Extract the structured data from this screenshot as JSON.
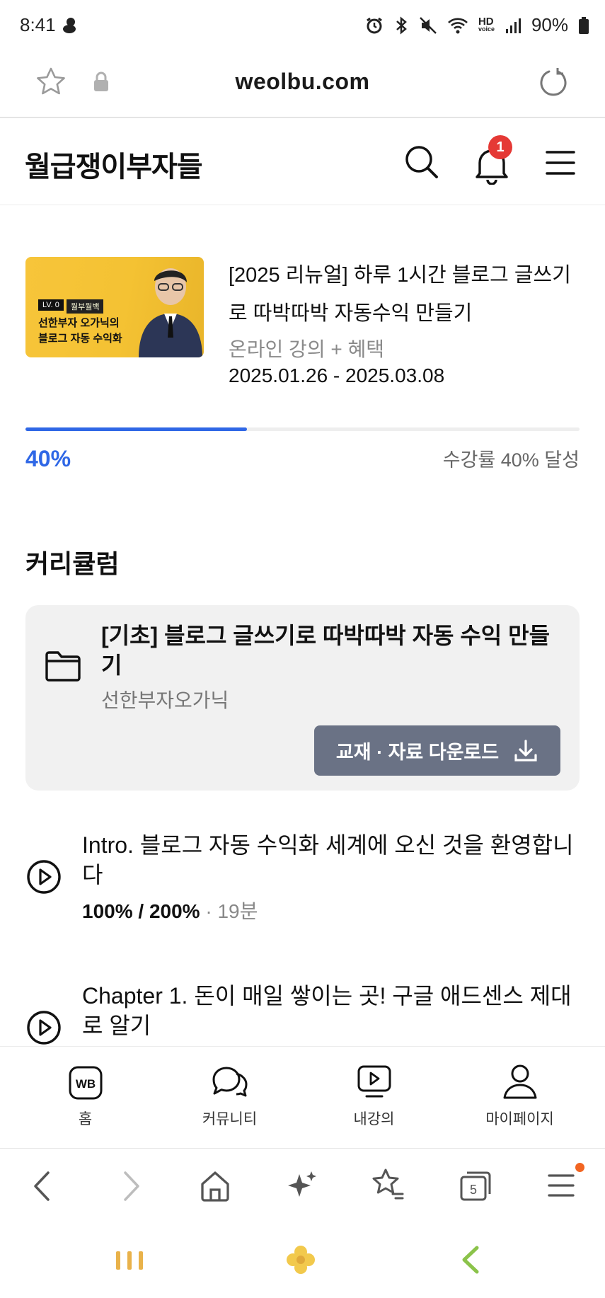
{
  "status_bar": {
    "time": "8:41",
    "hd_label": "HD",
    "hd_sub": "voice",
    "battery": "90%"
  },
  "browser": {
    "url": "weolbu.com",
    "tab_count": "5"
  },
  "app_header": {
    "logo": "월급쟁이부자들",
    "notification_count": "1"
  },
  "course": {
    "thumb_lv": "LV. 0",
    "thumb_tag": "월부월백",
    "thumb_line1": "선한부자 오가닉의",
    "thumb_line2": "블로그 자동 수익화",
    "title": "[2025 리뉴얼] 하루 1시간 블로그 글쓰기로 따박따박 자동수익 만들기",
    "type": "온라인 강의 + 혜택",
    "dates": "2025.01.26 - 2025.03.08",
    "progress_percent": 40,
    "progress_label": "40%",
    "progress_note": "수강률 40% 달성"
  },
  "curriculum": {
    "heading": "커리큘럼",
    "box_title": "[기초] 블로그 글쓰기로 따박따박 자동 수익 만들기",
    "box_author": "선한부자오가닉",
    "download_label": "교재 · 자료 다운로드",
    "lessons": [
      {
        "title": "Intro. 블로그 자동 수익화 세계에 오신 것을 환영합니다",
        "progress": "100% / 200%",
        "duration": "· 19분"
      },
      {
        "title": "Chapter 1. 돈이 매일 쌓이는 곳! 구글 애드센스 제대로 알기"
      }
    ]
  },
  "app_nav": {
    "home": "홈",
    "home_icon_text": "WB",
    "community": "커뮤니티",
    "my_lectures": "내강의",
    "mypage": "마이페이지"
  },
  "colors": {
    "accent": "#2f67e6",
    "badge": "#e53935",
    "button": "#6a7285"
  }
}
